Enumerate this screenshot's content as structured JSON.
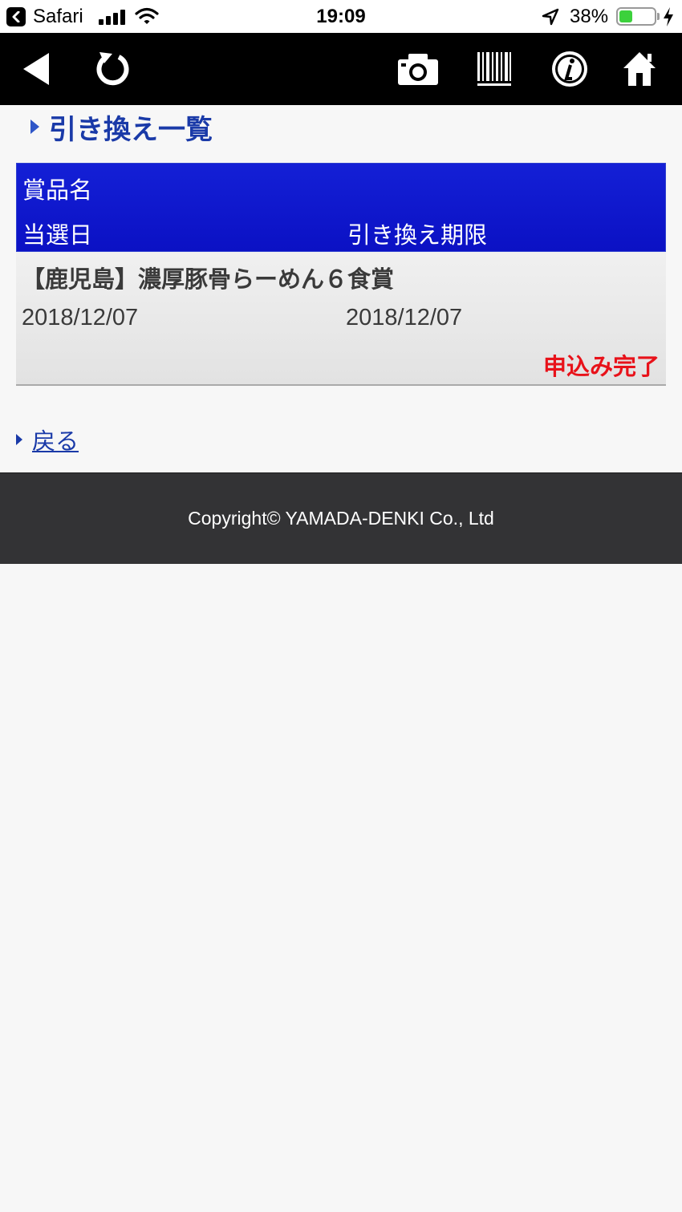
{
  "status_bar": {
    "back_app": "Safari",
    "time": "19:09",
    "battery_percent": "38%",
    "battery_level": 0.38,
    "icons": [
      "back-to-app-icon",
      "signal-icon",
      "wifi-icon",
      "location-icon",
      "battery-icon",
      "charging-icon"
    ]
  },
  "toolbar": {
    "icons": [
      "back-arrow-icon",
      "refresh-icon",
      "camera-icon",
      "barcode-icon",
      "info-icon",
      "home-icon"
    ]
  },
  "page": {
    "title": "引き換え一覧"
  },
  "table": {
    "headers": {
      "prize": "賞品名",
      "win_date": "当選日",
      "expiry": "引き換え期限"
    },
    "rows": [
      {
        "prize": "【鹿児島】濃厚豚骨らーめん６食賞",
        "win_date": "2018/12/07",
        "expiry": "2018/12/07",
        "status": "申込み完了"
      }
    ]
  },
  "back_link": "戻る",
  "footer": {
    "copyright": "Copyright© YAMADA-DENKI Co., Ltd"
  },
  "colors": {
    "header_blue": "#1420d6",
    "title_blue": "#1a3aa8",
    "status_red": "#e8121a",
    "footer_bg": "#333335"
  }
}
